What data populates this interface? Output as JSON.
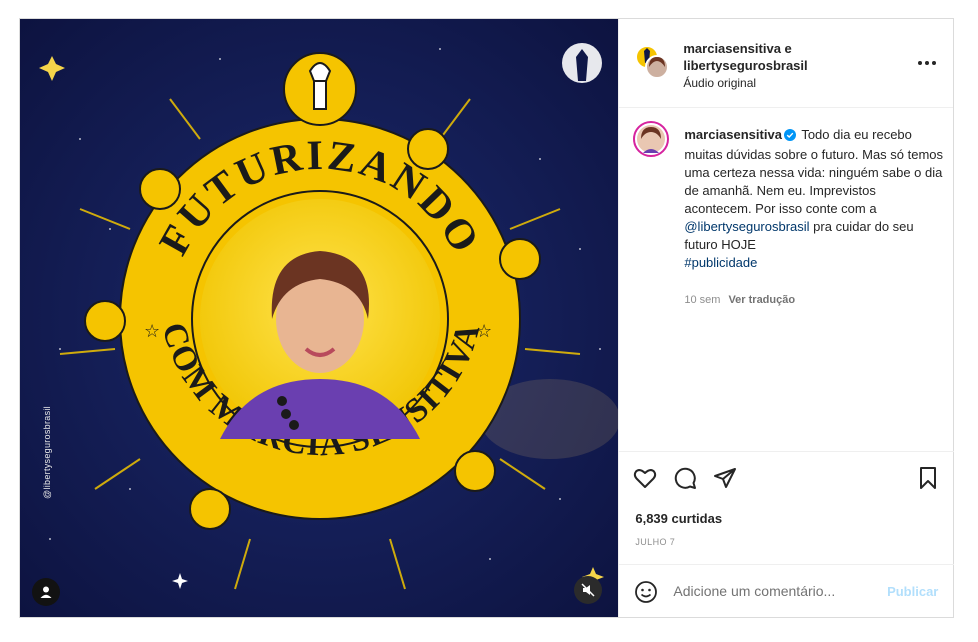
{
  "post": {
    "header": {
      "author_line1": "marciasensitiva e",
      "author_line2": "libertysegurosbrasil",
      "audio": "Áudio original",
      "more_icon": "more-horizontal-icon"
    },
    "media": {
      "ring_text_top": "FUTURIZANDO",
      "ring_text_bottom": "COM MÁRCIA SENSITIVA",
      "credit": "@libertysegurosbrasil",
      "colors": {
        "background": "#0f1748",
        "gold": "#f5c400",
        "inner": "#f7d000",
        "ink": "#1a1a1a"
      }
    },
    "caption": {
      "username": "marciasensitiva",
      "text_intro": " Todo dia eu recebo muitas dúvidas sobre o futuro. Mas só temos uma certeza nessa vida: ninguém sabe o dia de amanhã. Nem eu. Imprevistos acontecem. Por isso conte com a ",
      "mention": "@libertysegurosbrasil",
      "text_after": " pra cuidar do seu futuro HOJE",
      "hashtag": "#publicidade",
      "age": "10 sem",
      "translate": "Ver tradução"
    },
    "stats": {
      "likes": "6,839 curtidas",
      "date": "JULHO 7"
    },
    "comment": {
      "placeholder": "Adicione um comentário...",
      "post_label": "Publicar"
    }
  }
}
